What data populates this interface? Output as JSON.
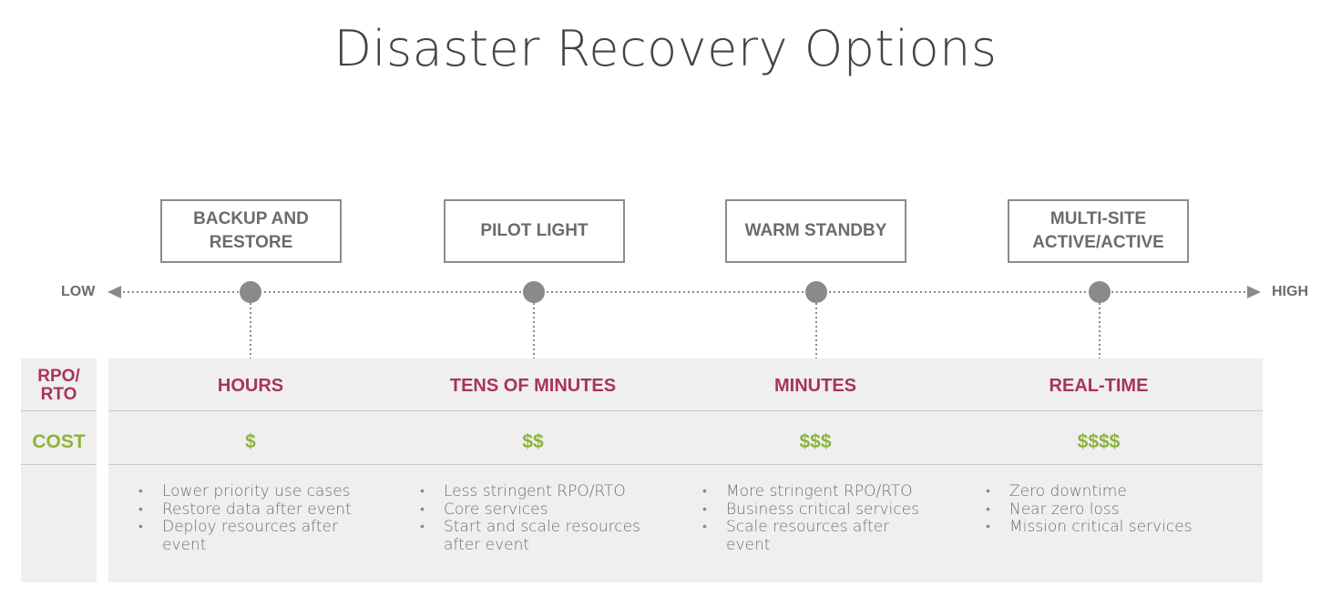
{
  "title": "Disaster Recovery Options",
  "axis": {
    "low": "LOW",
    "high": "HIGH"
  },
  "row_labels": {
    "rpo_rto": "RPO/\nRTO",
    "cost": "COST"
  },
  "options": [
    {
      "name": "BACKUP AND\nRESTORE",
      "rpo_rto": "HOURS",
      "cost": "$",
      "bullets": [
        "Lower priority use cases",
        "Restore data after event",
        "Deploy resources after event"
      ]
    },
    {
      "name": "PILOT LIGHT",
      "rpo_rto": "TENS OF MINUTES",
      "cost": "$$",
      "bullets": [
        "Less stringent RPO/RTO",
        "Core services",
        "Start and scale resources after event"
      ]
    },
    {
      "name": "WARM STANDBY",
      "rpo_rto": "MINUTES",
      "cost": "$$$",
      "bullets": [
        "More stringent RPO/RTO",
        "Business critical services",
        "Scale resources after event"
      ]
    },
    {
      "name": "MULTI-SITE\nACTIVE/ACTIVE",
      "rpo_rto": "REAL-TIME",
      "cost": "$$$$",
      "bullets": [
        "Zero downtime",
        "Near zero loss",
        "Mission critical services"
      ]
    }
  ],
  "colors": {
    "rpo": "#a8335f",
    "cost": "#8db33a",
    "node": "#8a8a8a",
    "box_border": "#8c8c8c"
  }
}
